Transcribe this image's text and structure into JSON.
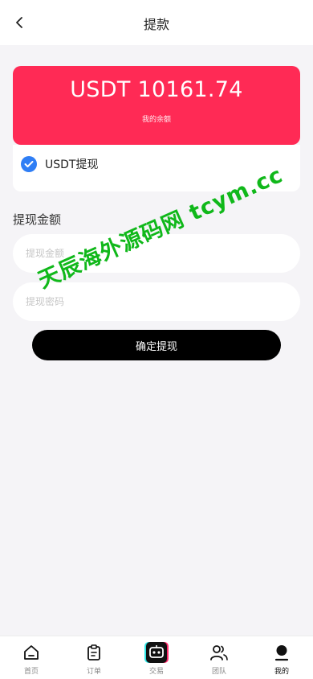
{
  "header": {
    "title": "提款"
  },
  "balance": {
    "amount": "USDT 10161.74",
    "label": "我的余额"
  },
  "method": {
    "label": "USDT提现",
    "selected": true,
    "accent_color": "#2f7ef5"
  },
  "form": {
    "section_title": "提现金额",
    "amount_placeholder": "提现金额",
    "password_placeholder": "提现密码",
    "submit_label": "确定提现"
  },
  "watermark": "天辰海外源码网 tcym.cc",
  "colors": {
    "card": "#ff2a55",
    "background": "#f5f4f7",
    "button": "#000000"
  },
  "tabbar": {
    "items": [
      {
        "label": "首页",
        "icon": "home-icon"
      },
      {
        "label": "订单",
        "icon": "clipboard-icon"
      },
      {
        "label": "交易",
        "icon": "robot-icon"
      },
      {
        "label": "团队",
        "icon": "team-icon"
      },
      {
        "label": "我的",
        "icon": "user-icon",
        "active": true
      }
    ]
  }
}
